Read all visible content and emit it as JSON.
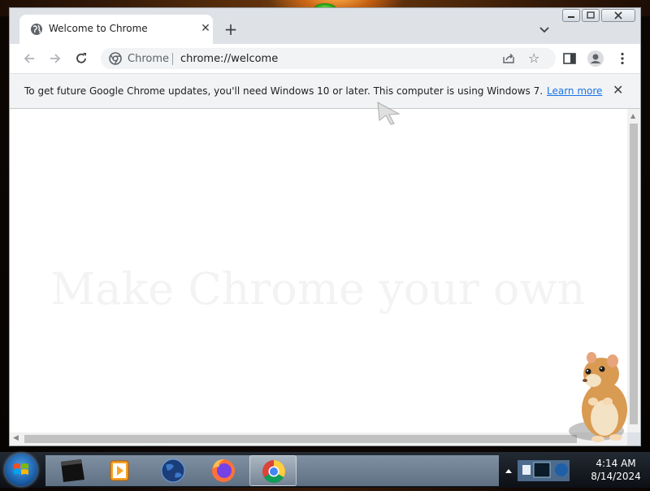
{
  "browser": {
    "tab": {
      "title": "Welcome to Chrome",
      "close_symbol": "✕"
    },
    "new_tab_symbol": "+",
    "omnibox": {
      "chip": "Chrome",
      "url": "chrome://welcome"
    },
    "infobar": {
      "message": "To get future Google Chrome updates, you'll need Windows 10 or later. This computer is using Windows 7.",
      "link": "Learn more",
      "close_symbol": "✕"
    },
    "ghost_heading": "Make Chrome your own"
  },
  "taskbar": {
    "apps": [
      "cmd-icon",
      "media-player-icon",
      "globe-icon",
      "firefox-icon",
      "chrome-icon"
    ],
    "clock": {
      "time": "4:14 AM",
      "date": "8/14/2024"
    }
  },
  "colors": {
    "link": "#1a73e8",
    "tab_strip": "#dee1e6",
    "omnibox": "#f1f3f4"
  }
}
